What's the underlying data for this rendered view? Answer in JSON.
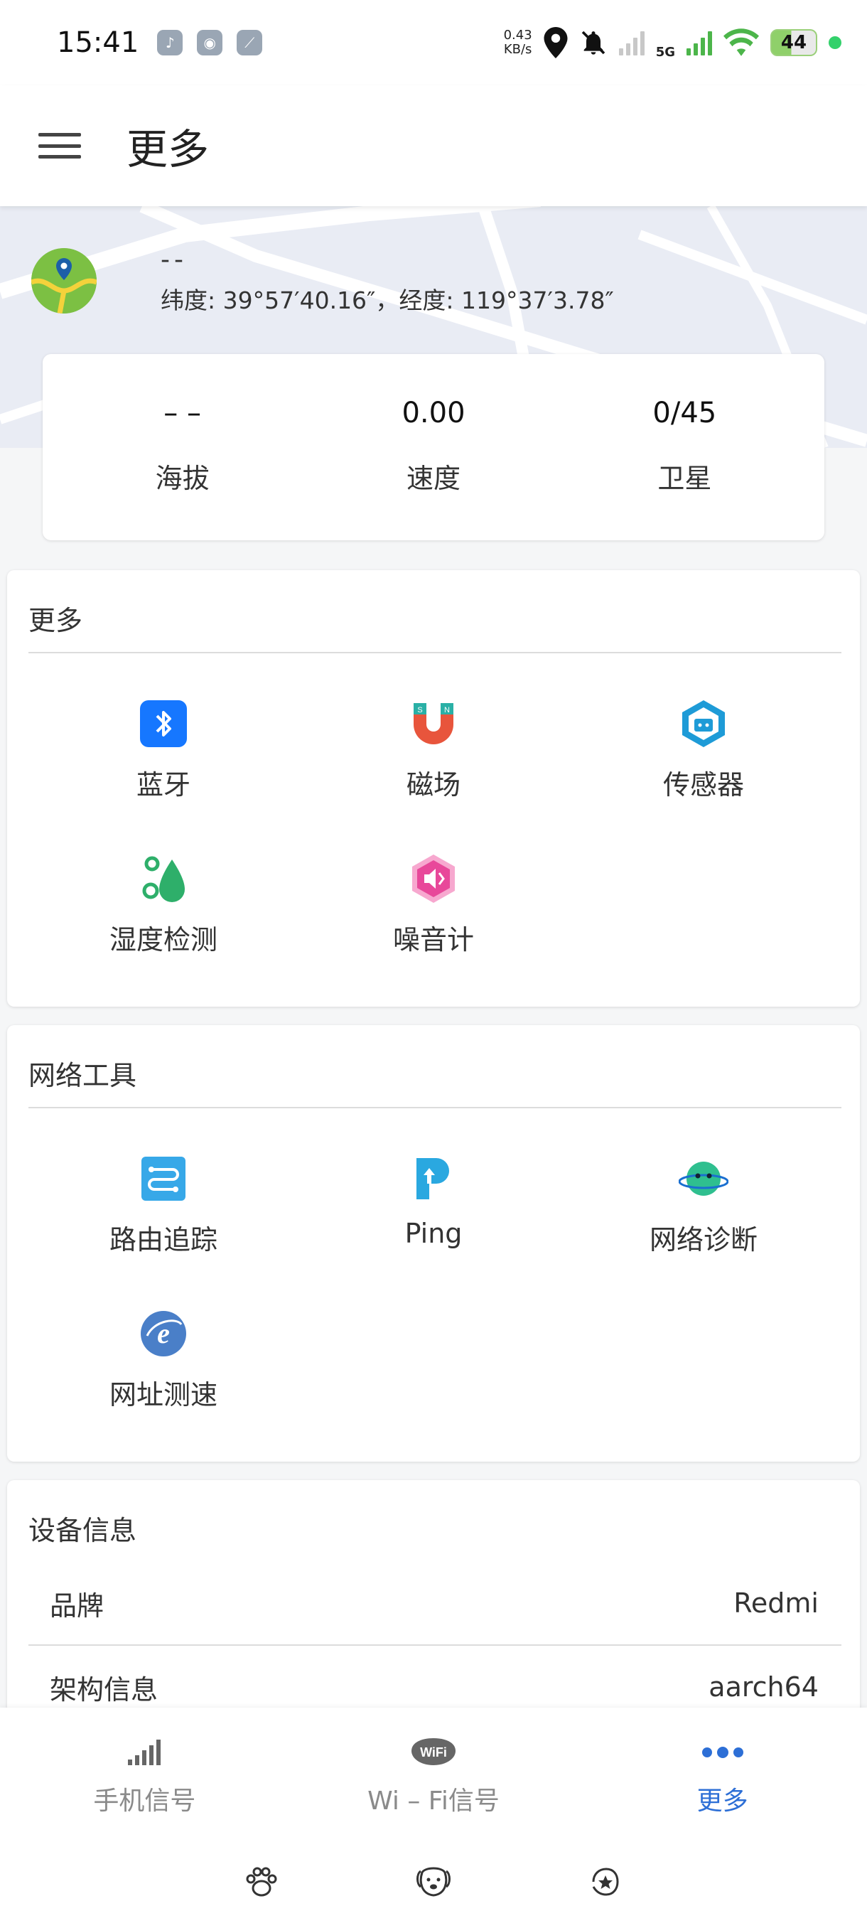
{
  "status_bar": {
    "time": "15:41",
    "net_speed_value": "0.43",
    "net_speed_unit": "KB/s",
    "network_type": "5G",
    "battery_level": "44"
  },
  "app_bar": {
    "title": "更多"
  },
  "location": {
    "name": "--",
    "coords": "纬度: 39°57′40.16″，经度: 119°37′3.78″"
  },
  "stats": [
    {
      "value": "– –",
      "label": "海拔"
    },
    {
      "value": "0.00",
      "label": "速度"
    },
    {
      "value": "0/45",
      "label": "卫星"
    }
  ],
  "more_section": {
    "title": "更多",
    "items": [
      {
        "label": "蓝牙",
        "icon": "bluetooth-icon"
      },
      {
        "label": "磁场",
        "icon": "magnet-icon"
      },
      {
        "label": "传感器",
        "icon": "sensor-icon"
      },
      {
        "label": "湿度检测",
        "icon": "humidity-icon"
      },
      {
        "label": "噪音计",
        "icon": "noise-meter-icon"
      }
    ]
  },
  "network_section": {
    "title": "网络工具",
    "items": [
      {
        "label": "路由追踪",
        "icon": "route-trace-icon"
      },
      {
        "label": "Ping",
        "icon": "ping-icon"
      },
      {
        "label": "网络诊断",
        "icon": "network-diagnosis-icon"
      },
      {
        "label": "网址测速",
        "icon": "url-speed-icon"
      }
    ]
  },
  "device_section": {
    "title": "设备信息",
    "rows": [
      {
        "key": "品牌",
        "value": "Redmi"
      },
      {
        "key": "架构信息",
        "value": "aarch64"
      }
    ]
  },
  "bottom_nav": {
    "items": [
      {
        "label": "手机信号",
        "icon": "signal-bars-icon"
      },
      {
        "label": "Wi – Fi信号",
        "icon": "wifi-icon"
      },
      {
        "label": "更多",
        "icon": "more-dots-icon"
      }
    ],
    "active_color": "#2d6fd6"
  },
  "colors": {
    "accent": "#2d6fd6",
    "bluetooth": "#1677ff",
    "magnet": "#e8553c",
    "sensor": "#1e9bd7",
    "humidity": "#2eaf6a",
    "noise": "#e8489a",
    "route": "#37a8e8",
    "ping": "#2aa8e0",
    "diagnosis": "#2fbf8f",
    "url_speed": "#4a7fc8"
  }
}
